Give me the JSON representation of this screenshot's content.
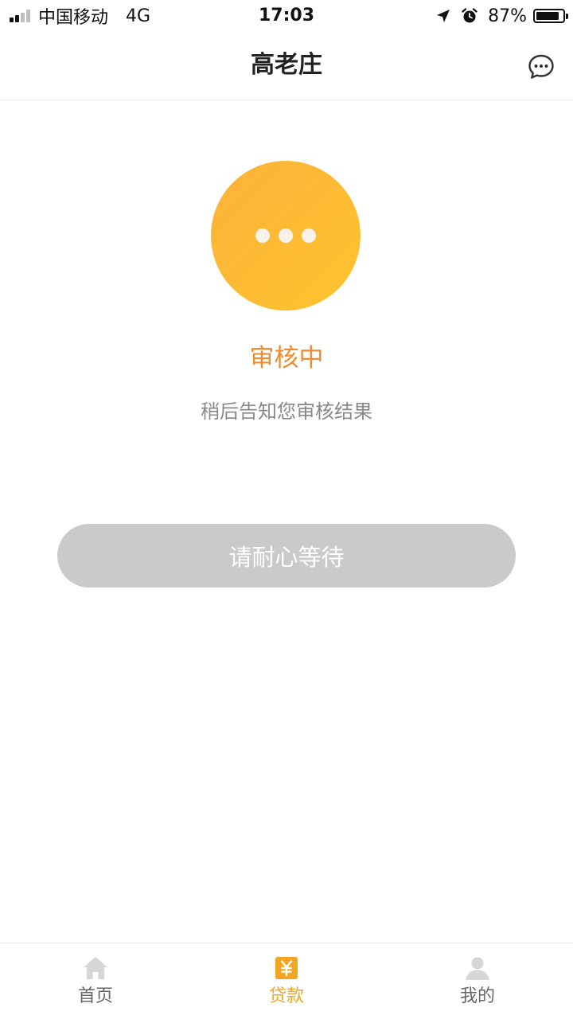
{
  "status_bar": {
    "carrier": "中国移动",
    "network": "4G",
    "time": "17:03",
    "battery_percent_label": "87%",
    "battery_level": 0.87
  },
  "nav": {
    "title": "高老庄",
    "message_icon": "message-bubble-icon"
  },
  "main": {
    "status_icon": "more-dots-icon",
    "status_text": "审核中",
    "hint_text": "稍后告知您审核结果",
    "button_label": "请耐心等待"
  },
  "tabs": [
    {
      "label": "首页",
      "icon": "home-icon",
      "active": false
    },
    {
      "label": "贷款",
      "icon": "yuan-icon",
      "active": true
    },
    {
      "label": "我的",
      "icon": "user-icon",
      "active": false
    }
  ],
  "colors": {
    "accent": "#f2a623",
    "status_text": "#f08c2e",
    "circle_start": "#fbb23a",
    "circle_end": "#fec42d",
    "disabled_button": "#c9cacc"
  }
}
